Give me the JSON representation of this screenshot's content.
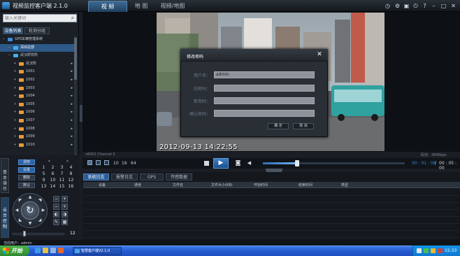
{
  "window": {
    "title": "视频监控客户端 2.1.0",
    "tabs": [
      "视 频",
      "地 图",
      "视频/地图"
    ],
    "icons": [
      "clock-icon",
      "settings-icon",
      "lock-icon",
      "exit-icon",
      "help-icon",
      "minimize-icon",
      "maximize-icon",
      "close-icon"
    ]
  },
  "sidebar": {
    "search_placeholder": "输入关键词",
    "tabs": [
      "设备列表",
      "轮询分组"
    ],
    "tree": [
      {
        "label": "GPS车辆管理系统",
        "level": 0
      },
      {
        "label": "深圳总部",
        "level": 1
      },
      {
        "label": "武汉研究所",
        "level": 1
      },
      {
        "label": "武汉所",
        "level": 2
      },
      {
        "label": "1001",
        "level": 2
      },
      {
        "label": "1002",
        "level": 2
      },
      {
        "label": "1003",
        "level": 2
      },
      {
        "label": "1004",
        "level": 2
      },
      {
        "label": "1005",
        "level": 2
      },
      {
        "label": "1006",
        "level": 2
      },
      {
        "label": "1007",
        "level": 2
      },
      {
        "label": "1008",
        "level": 2
      },
      {
        "label": "1009",
        "level": 2
      },
      {
        "label": "1010",
        "level": 2
      }
    ]
  },
  "ptz": {
    "vtabs": [
      "基本操作",
      "云台控制"
    ],
    "buttons": [
      "调用",
      "设置",
      "删除",
      "默认"
    ],
    "nav_prev": "«",
    "nav_next": "»",
    "presets": [
      "1",
      "2",
      "3",
      "4",
      "5",
      "6",
      "7",
      "8",
      "9",
      "10",
      "11",
      "12",
      "13",
      "14",
      "15",
      "16"
    ],
    "speed_value": "12",
    "speed_fraction": 0.23
  },
  "video": {
    "channel_label": "v6001 Channel 3",
    "bitrate_label": "码流：284Kbps",
    "osd_time": "2012-09-13   14:22:55",
    "layouts": [
      "10",
      "16",
      "64"
    ],
    "time_current": "00 : 01 : 06",
    "time_separator": "/",
    "time_total": "00 : 05 : 00",
    "progress": 0.24
  },
  "dialog": {
    "title": "修改密码",
    "close": "✕",
    "fields": [
      {
        "label": "用户名：",
        "value": "admin"
      },
      {
        "label": "旧密码：",
        "value": ""
      },
      {
        "label": "新密码：",
        "value": ""
      },
      {
        "label": "确认密码：",
        "value": ""
      }
    ],
    "ok": "确 定",
    "cancel": "取 消"
  },
  "logs": {
    "tabs": [
      "系统日志",
      "报警日志",
      "GPS",
      "传感数据"
    ],
    "columns": [
      "设备",
      "通道",
      "文件名",
      "文件大小(KB)",
      "开始时间",
      "结束时间",
      "类型"
    ]
  },
  "status": {
    "user": "当前用户：admin"
  },
  "taskbar": {
    "start": "开始",
    "app": "智慧客户端V2.1.0",
    "clock": "15:33"
  }
}
